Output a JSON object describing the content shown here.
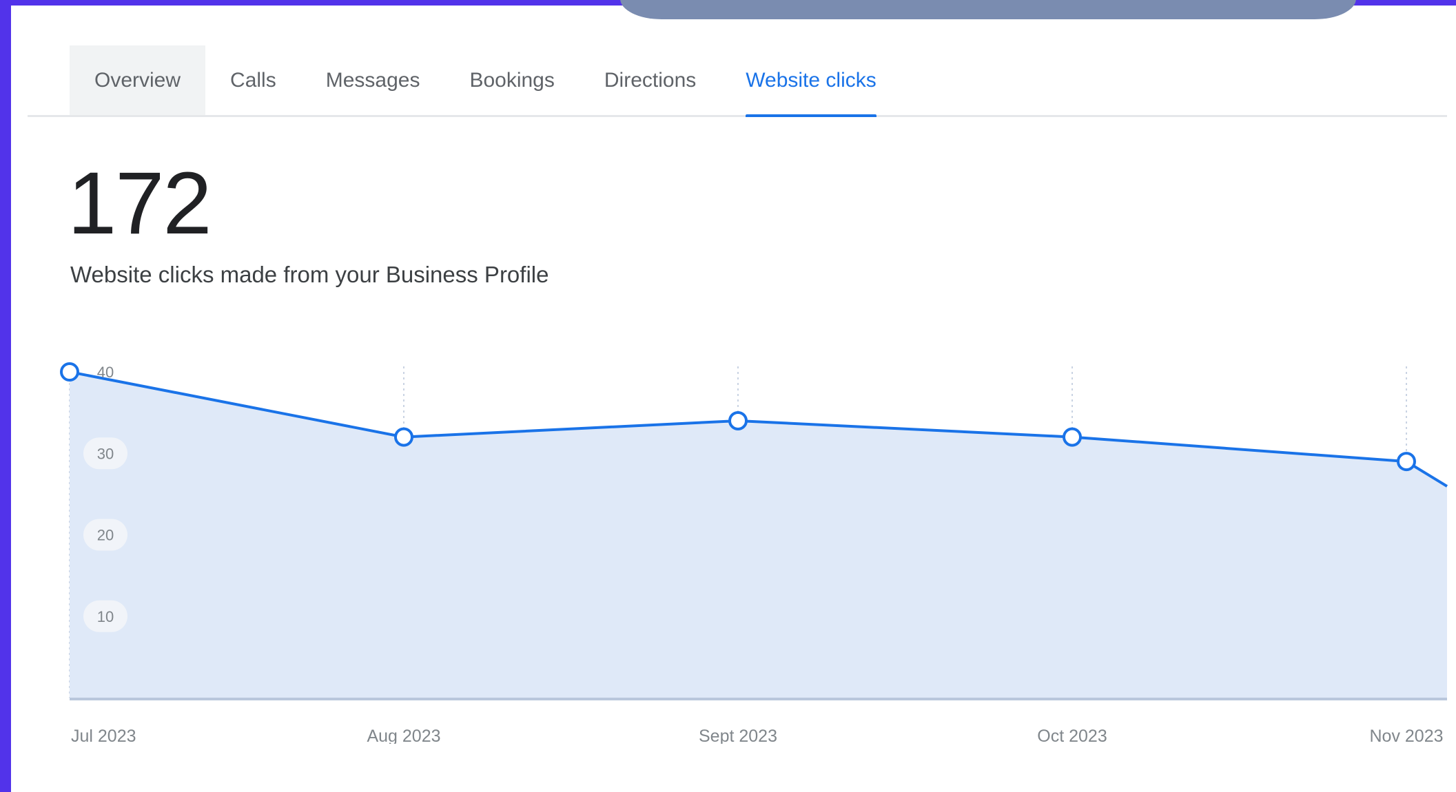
{
  "tabs": [
    {
      "label": "Overview",
      "active": false
    },
    {
      "label": "Calls",
      "active": false
    },
    {
      "label": "Messages",
      "active": false
    },
    {
      "label": "Bookings",
      "active": false
    },
    {
      "label": "Directions",
      "active": false
    },
    {
      "label": "Website clicks",
      "active": true
    }
  ],
  "summary": {
    "total": "172",
    "description": "Website clicks made from your Business Profile"
  },
  "colors": {
    "accent": "#1a73e8",
    "area_fill": "#dfe9f8",
    "frame": "#5233ea"
  },
  "chart_data": {
    "type": "area",
    "categories": [
      "Jul 2023",
      "Aug 2023",
      "Sept 2023",
      "Oct 2023",
      "Nov 2023"
    ],
    "values": [
      40,
      32,
      34,
      32,
      29
    ],
    "yticks": [
      10,
      20,
      30,
      40
    ],
    "ylim": [
      0,
      40
    ],
    "grid": "vertical dotted",
    "title": "",
    "xlabel": "",
    "ylabel": ""
  }
}
